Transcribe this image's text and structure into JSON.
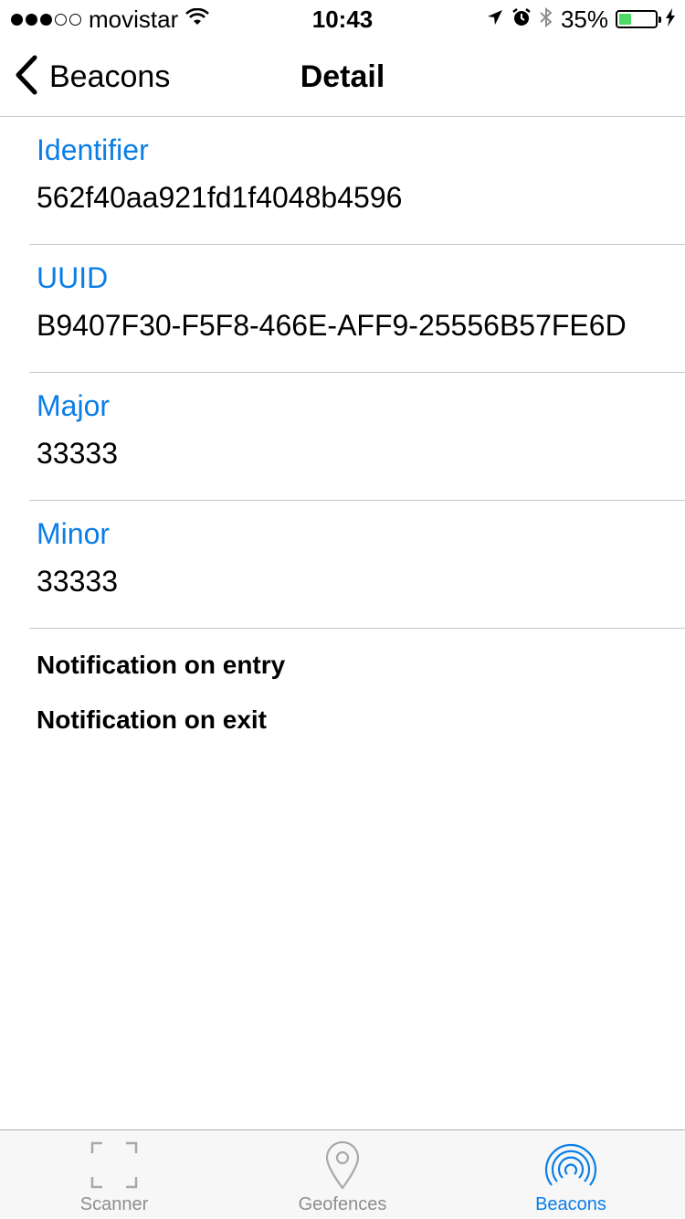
{
  "status_bar": {
    "signal": "●●●○○",
    "carrier": "movistar",
    "time": "10:43",
    "battery_percent": "35%",
    "battery_level": 0.35,
    "battery_color": "#4cd964",
    "icons": [
      "wifi-icon",
      "location-arrow-icon",
      "alarm-icon",
      "bluetooth-icon",
      "battery-icon",
      "charging-bolt-icon"
    ]
  },
  "nav": {
    "back_label": "Beacons",
    "title": "Detail"
  },
  "fields": [
    {
      "label": "Identifier",
      "value": "562f40aa921fd1f4048b4596"
    },
    {
      "label": "UUID",
      "value": "B9407F30-F5F8-466E-AFF9-25556B57FE6D"
    },
    {
      "label": "Major",
      "value": "33333"
    },
    {
      "label": "Minor",
      "value": "33333"
    }
  ],
  "notifications": {
    "entry": "Notification on entry",
    "exit": "Notification on exit"
  },
  "tabs": [
    {
      "label": "Scanner",
      "icon": "scanner-frame-icon",
      "active": false
    },
    {
      "label": "Geofences",
      "icon": "map-pin-icon",
      "active": false
    },
    {
      "label": "Beacons",
      "icon": "beacon-signal-icon",
      "active": true
    }
  ],
  "colors": {
    "accent": "#0b7ee6",
    "inactive": "#8e8e93"
  }
}
